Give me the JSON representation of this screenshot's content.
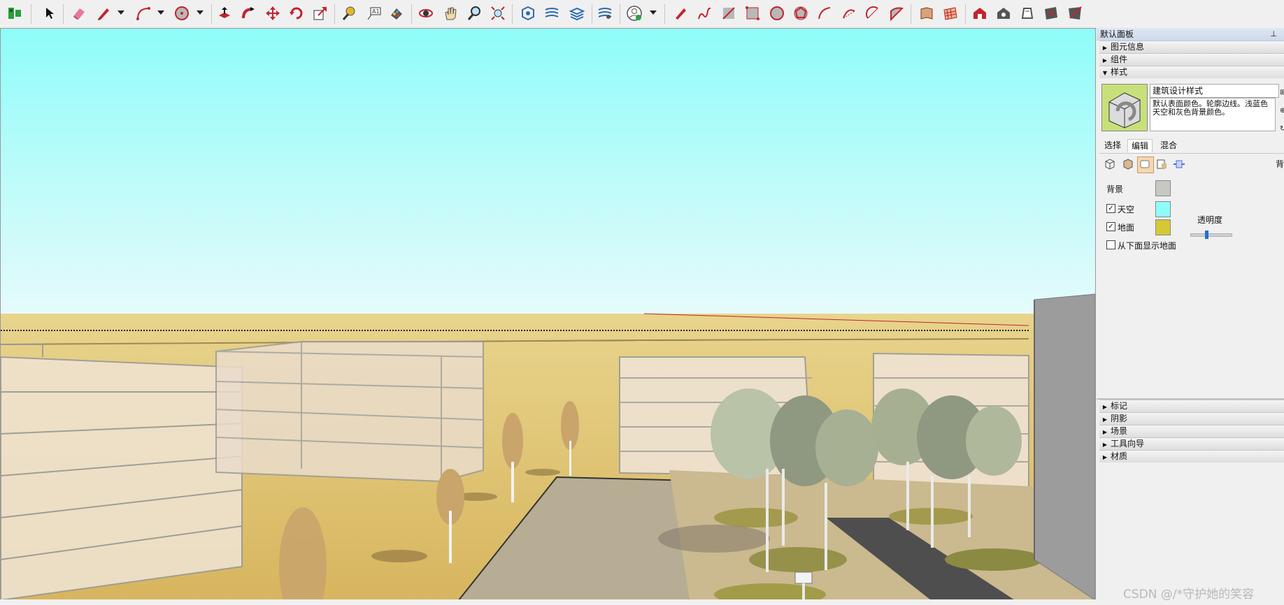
{
  "panel": {
    "title": "默认面板",
    "pin": "ᵽ",
    "trays_top": [
      {
        "label": "图元信息",
        "state": "collapsed"
      },
      {
        "label": "组件",
        "state": "collapsed"
      },
      {
        "label": "样式",
        "state": "expanded"
      }
    ],
    "style": {
      "name": "建筑设计样式",
      "description": "默认表面颜色。轮廓边线。浅蓝色天空和灰色背景颜色。"
    },
    "tabs": [
      "选择",
      "编辑",
      "混合"
    ],
    "active_tab": "编辑",
    "right_cutoff": "背",
    "settings": {
      "background_label": "背景",
      "background_color": "#c8c8c2",
      "sky_label": "天空",
      "sky_checked": true,
      "sky_color": "#8ffcf9",
      "ground_label": "地面",
      "ground_checked": true,
      "ground_color": "#d4c837",
      "transparency_label": "透明度",
      "show_ground_below_label": "从下面显示地面",
      "show_ground_below_checked": false
    },
    "trays_bottom": [
      {
        "label": "标记"
      },
      {
        "label": "阴影"
      },
      {
        "label": "场景"
      },
      {
        "label": "工具向导"
      },
      {
        "label": "材质"
      }
    ]
  },
  "watermark": "CSDN @/*守护她的笑容",
  "icons": [
    "component-icon",
    "select-icon",
    "eraser-icon",
    "pencil-icon",
    "arc-icon",
    "circle-icon",
    "pushpull-icon",
    "followme-icon",
    "move-icon",
    "rotate-icon",
    "scale-icon",
    "tape-icon",
    "text-icon",
    "paint-icon",
    "orbit-icon",
    "pan-icon",
    "zoom-icon",
    "zoom-extents-icon",
    "sandbox-icon",
    "account-icon",
    "line-icon",
    "freehand-icon",
    "rectangle-icon",
    "polygon-icon",
    "pie-icon",
    "layout-icon"
  ]
}
